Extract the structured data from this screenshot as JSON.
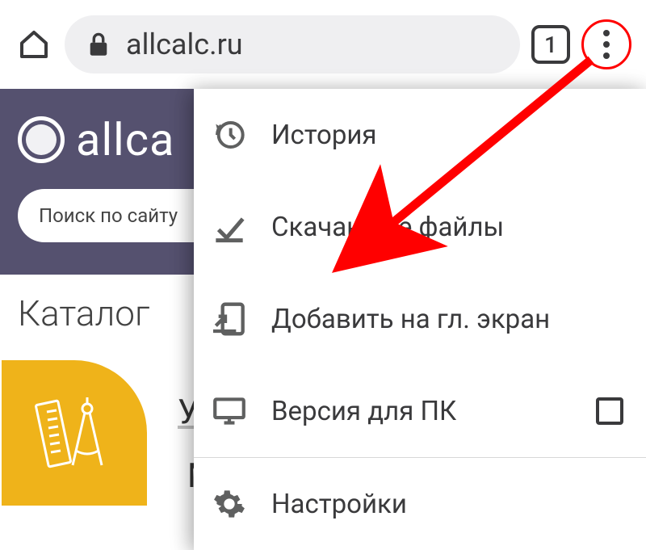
{
  "chrome": {
    "url": "allcalc.ru",
    "tabsCount": "1"
  },
  "page": {
    "logoText": "allca",
    "searchPlaceholder": "Поиск по сайту",
    "catalogTitle": "Каталог",
    "sideLetter1": "У",
    "sideLetter2": "М"
  },
  "menu": {
    "history": "История",
    "downloads": "Скачанные файлы",
    "addHome": "Добавить на гл. экран",
    "desktopVersion": "Версия для ПК",
    "settings": "Настройки"
  }
}
